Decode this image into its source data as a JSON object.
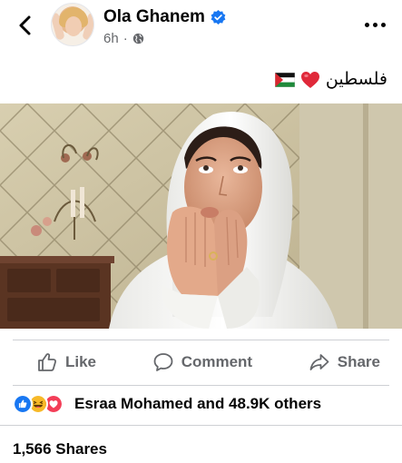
{
  "header": {
    "back_icon": "chevron-left-icon",
    "author_name": "Ola Ghanem",
    "verified_icon": "verified-badge-icon",
    "time": "6h",
    "dot": "·",
    "privacy_icon": "globe-icon",
    "more_icon": "more-horizontal-icon"
  },
  "post": {
    "caption_text": "فلسطين",
    "caption_emojis": [
      "red-heart-icon",
      "palestine-flag-icon"
    ]
  },
  "actions": [
    {
      "label": "Like",
      "icon": "thumbs-up-icon"
    },
    {
      "label": "Comment",
      "icon": "comment-icon"
    },
    {
      "label": "Share",
      "icon": "share-icon"
    }
  ],
  "reactions": {
    "icons": [
      "like-reaction-icon",
      "haha-reaction-icon",
      "love-reaction-icon"
    ],
    "summary": "Esraa Mohamed and 48.9K others"
  },
  "shares": {
    "label": "1,566 Shares"
  },
  "colors": {
    "verified": "#1877f2",
    "secondary_text": "#65676b",
    "like": "#1877f2",
    "love": "#f33e58",
    "haha": "#f7b928"
  }
}
